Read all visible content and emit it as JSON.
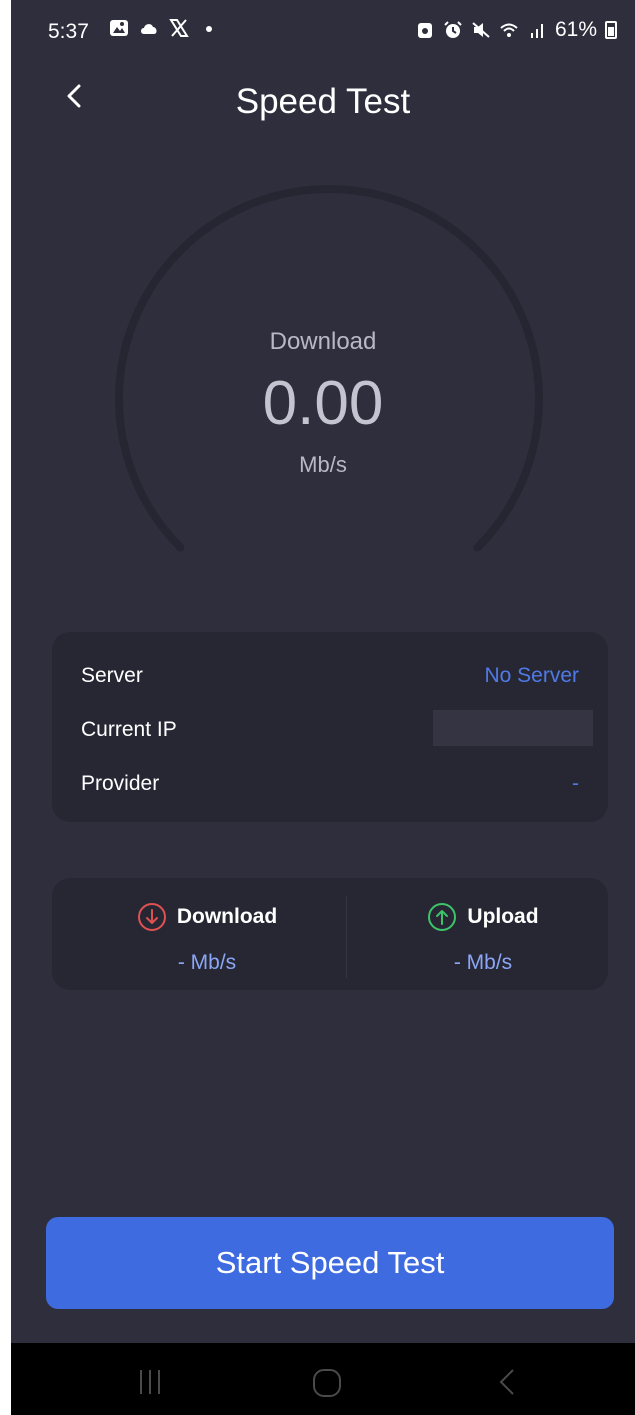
{
  "status_bar": {
    "time": "5:37",
    "battery": "61%",
    "left_icons": [
      "gallery-icon",
      "cloud-icon",
      "x-logo-icon",
      "dot-icon"
    ],
    "right_icons": [
      "lock-icon",
      "alarm-icon",
      "mute-icon",
      "wifi-icon",
      "signal-icon",
      "battery-icon"
    ]
  },
  "header": {
    "title": "Speed Test"
  },
  "gauge": {
    "label": "Download",
    "value": "0.00",
    "unit": "Mb/s",
    "fill_fraction": 0
  },
  "info": {
    "server_label": "Server",
    "server_value": "No Server",
    "ip_label": "Current IP",
    "ip_value": "",
    "provider_label": "Provider",
    "provider_value": "-"
  },
  "results": {
    "download_label": "Download",
    "download_value": "- Mb/s",
    "upload_label": "Upload",
    "upload_value": "- Mb/s"
  },
  "start_button": "Start Speed Test",
  "colors": {
    "background": "#2e2e3d",
    "card": "#272734",
    "accent": "#3f6be0",
    "link": "#4f7ae6",
    "download_icon": "#e05252",
    "upload_icon": "#3dc46a"
  }
}
